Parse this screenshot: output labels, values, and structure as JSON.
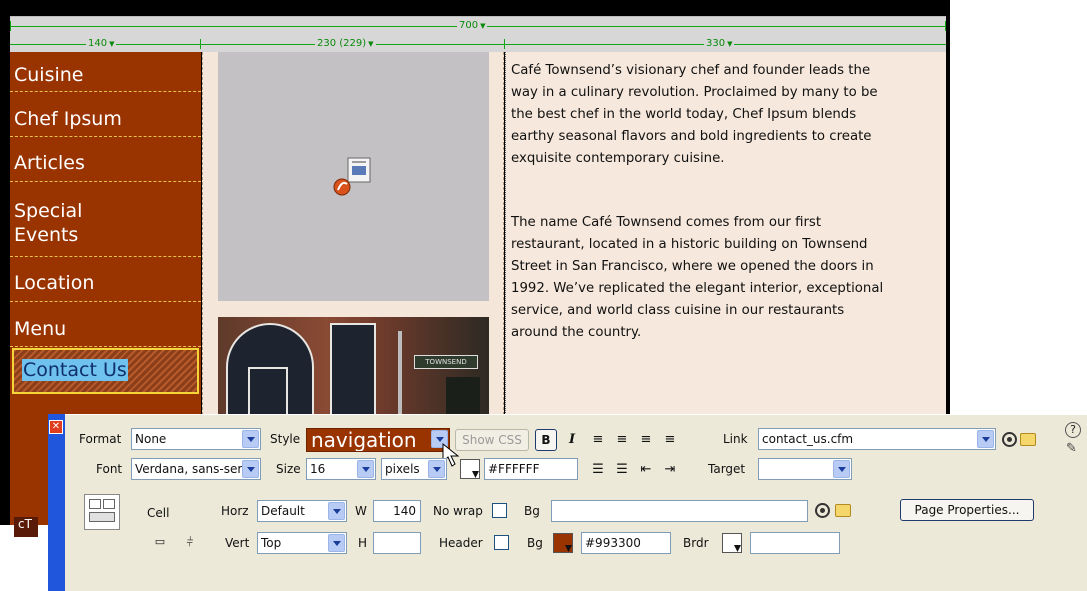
{
  "ruler": {
    "total": "700",
    "col1": "140",
    "col2": "230 (229)",
    "col3": "330"
  },
  "sidebar": {
    "items": [
      {
        "label": "Cuisine"
      },
      {
        "label": "Chef Ipsum"
      },
      {
        "label": "Articles"
      },
      {
        "label": "Special\nEvents"
      },
      {
        "label": "Location"
      },
      {
        "label": "Menu"
      },
      {
        "label": "Contact Us",
        "selected": true
      }
    ],
    "bottom_tag": "cT"
  },
  "photo": {
    "street_sign": "TOWNSEND"
  },
  "content": {
    "para1": [
      "Café Townsend’s visionary chef and founder leads the",
      "way in a culinary revolution. Proclaimed by many to be",
      "the best chef in the world today, Chef Ipsum blends",
      "earthy seasonal flavors and bold ingredients to create",
      "exquisite contemporary cuisine."
    ],
    "para2": [
      "The name Café Townsend comes from our first",
      "restaurant, located in a historic building on Townsend",
      "Street in San Francisco, where we opened the doors in",
      "1992. We’ve replicated the elegant interior, exceptional",
      "service, and world class cuisine in our restaurants",
      "around the country."
    ]
  },
  "inspector": {
    "format_label": "Format",
    "format_value": "None",
    "style_label": "Style",
    "style_value": "navigation",
    "show_css": "Show CSS",
    "bold": "B",
    "italic": "I",
    "link_label": "Link",
    "link_value": "contact_us.cfm",
    "font_label": "Font",
    "font_value": "Verdana, sans-serif",
    "size_label": "Size",
    "size_value": "16",
    "size_unit": "pixels",
    "text_color": "#FFFFFF",
    "target_label": "Target",
    "target_value": "",
    "cell_label": "Cell",
    "horz_label": "Horz",
    "horz_value": "Default",
    "w_label": "W",
    "w_value": "140",
    "nowrap_label": "No wrap",
    "bg_label": "Bg",
    "bg_value": "",
    "page_properties": "Page Properties...",
    "vert_label": "Vert",
    "vert_value": "Top",
    "h_label": "H",
    "h_value": "",
    "header_label": "Header",
    "bg2_label": "Bg",
    "bg2_value": "#993300",
    "brdr_label": "Brdr",
    "brdr_value": "",
    "help_glyph": "?"
  },
  "colors": {
    "sidebar_bg": "#993300",
    "nav_text": "#FFFFFF",
    "content_bg": "#F6E8DC",
    "selection_highlight": "#6FC2EE",
    "inspector_bg": "#ECE9D8",
    "inspector_strip": "#1F56DC"
  }
}
